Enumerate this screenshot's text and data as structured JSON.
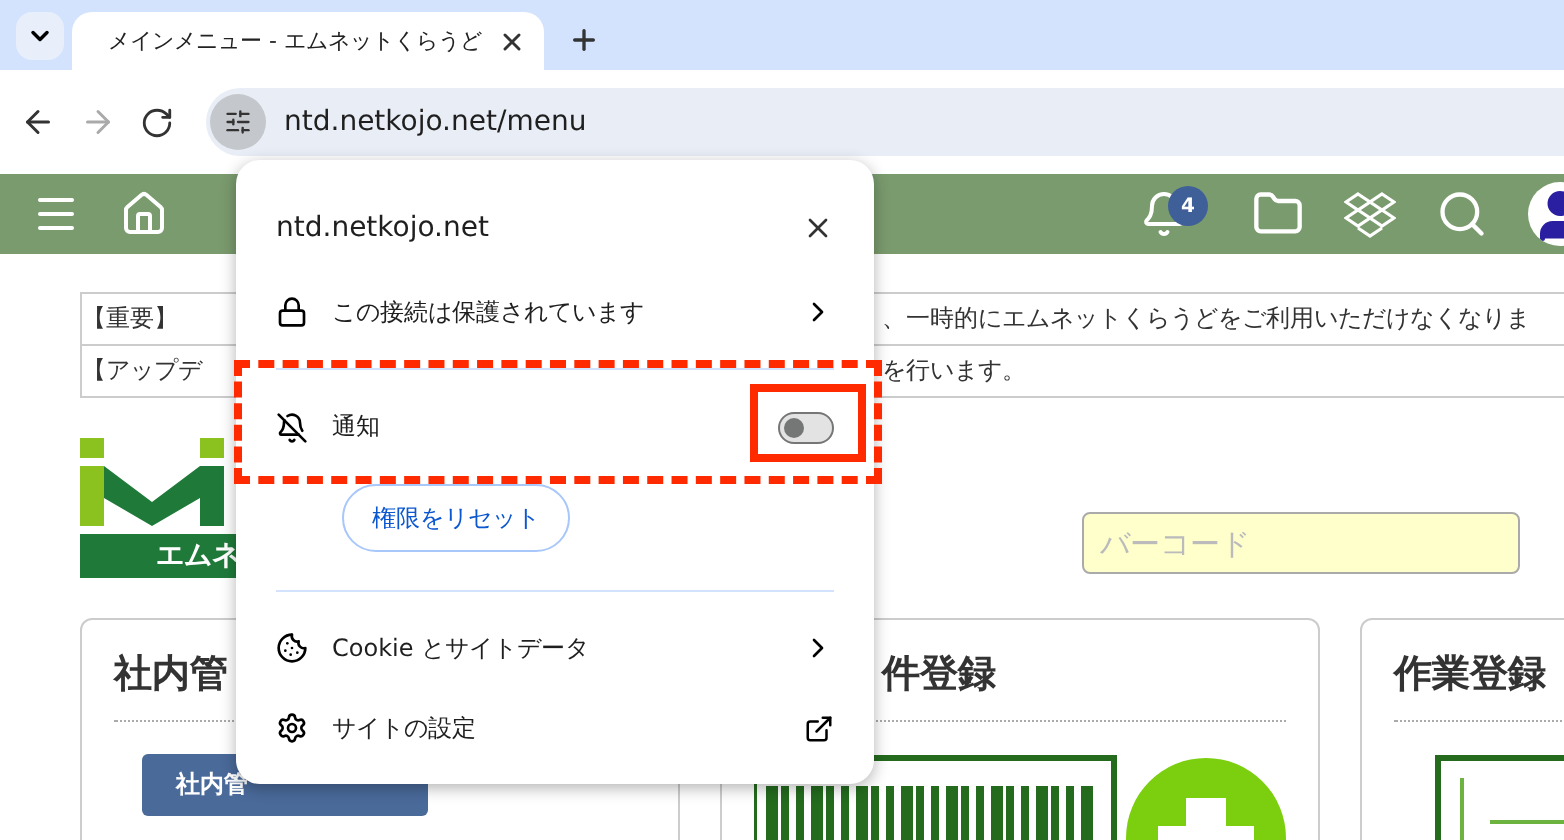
{
  "browser": {
    "tab": {
      "title": "メインメニュー - エムネットくらうど",
      "selected": true
    },
    "url": "ntd.netkojo.net/menu",
    "forward": {
      "disabled": true
    }
  },
  "nav": {
    "notification_count": "4"
  },
  "notices": [
    {
      "label": "【重要】",
      "text": "、一時的にエムネットくらうどをご利用いただけなくなりま"
    },
    {
      "label": "【アップデ",
      "text": "を行います。"
    }
  ],
  "logo": {
    "text": "エムネ"
  },
  "barcode": {
    "placeholder": "バーコード"
  },
  "cards": [
    {
      "kind": "button",
      "title": "社内管",
      "button": "社内管"
    },
    {
      "kind": "barcode",
      "title": "件登録"
    },
    {
      "kind": "list",
      "title": "作業登録"
    }
  ],
  "popup": {
    "site": "ntd.netkojo.net",
    "connection": "この接続は保護されています",
    "permissions": [
      {
        "label": "通知",
        "on": false
      }
    ],
    "reset_button": "権限をリセット",
    "links": [
      {
        "label": "Cookie とサイトデータ",
        "kind": "submenu"
      },
      {
        "label": "サイトの設定",
        "kind": "external"
      }
    ]
  }
}
